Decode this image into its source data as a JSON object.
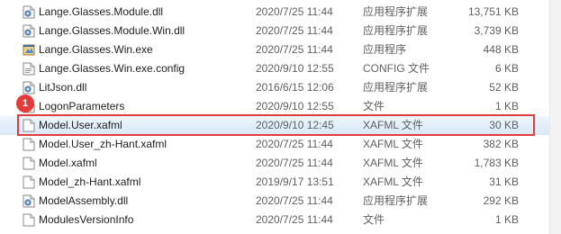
{
  "annotation": {
    "marker": "1"
  },
  "files": [
    {
      "name": "Lange.Glasses.Module.dll",
      "date": "2020/7/25 11:44",
      "type": "应用程序扩展",
      "size": "13,751 KB",
      "icon": "dll-icon"
    },
    {
      "name": "Lange.Glasses.Module.Win.dll",
      "date": "2020/7/25 11:44",
      "type": "应用程序扩展",
      "size": "3,739 KB",
      "icon": "dll-icon"
    },
    {
      "name": "Lange.Glasses.Win.exe",
      "date": "2020/7/25 11:44",
      "type": "应用程序",
      "size": "448 KB",
      "icon": "exe-icon"
    },
    {
      "name": "Lange.Glasses.Win.exe.config",
      "date": "2020/9/10 12:55",
      "type": "CONFIG 文件",
      "size": "6 KB",
      "icon": "config-file-icon"
    },
    {
      "name": "LitJson.dll",
      "date": "2016/6/15 12:06",
      "type": "应用程序扩展",
      "size": "52 KB",
      "icon": "dll-icon"
    },
    {
      "name": "LogonParameters",
      "date": "2020/9/10 12:55",
      "type": "文件",
      "size": "1 KB",
      "icon": "file-icon"
    },
    {
      "name": "Model.User.xafml",
      "date": "2020/9/10 12:45",
      "type": "XAFML 文件",
      "size": "30 KB",
      "icon": "file-icon",
      "selected": true
    },
    {
      "name": "Model.User_zh-Hant.xafml",
      "date": "2020/7/25 11:44",
      "type": "XAFML 文件",
      "size": "382 KB",
      "icon": "file-icon"
    },
    {
      "name": "Model.xafml",
      "date": "2020/7/25 11:44",
      "type": "XAFML 文件",
      "size": "1,783 KB",
      "icon": "file-icon"
    },
    {
      "name": "Model_zh-Hant.xafml",
      "date": "2019/9/17 13:51",
      "type": "XAFML 文件",
      "size": "31 KB",
      "icon": "file-icon"
    },
    {
      "name": "ModelAssembly.dll",
      "date": "2020/7/25 11:44",
      "type": "应用程序扩展",
      "size": "292 KB",
      "icon": "dll-icon"
    },
    {
      "name": "ModulesVersionInfo",
      "date": "2020/7/25 11:44",
      "type": "文件",
      "size": "1 KB",
      "icon": "file-icon"
    }
  ]
}
